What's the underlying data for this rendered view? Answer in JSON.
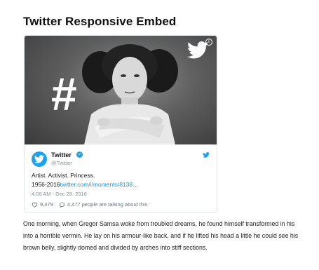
{
  "page": {
    "title": "Twitter Responsive Embed"
  },
  "embed": {
    "media": {
      "hashtag_glyph": "#",
      "bird_icon": "twitter-bird-icon",
      "info_icon": "info-icon",
      "info_glyph": "i"
    },
    "author": {
      "name": "Twitter",
      "handle": "@Twitter",
      "verified_glyph": "✓",
      "avatar_icon": "twitter-avatar"
    },
    "tweet": {
      "line1": "Artist. Activist. Princess.",
      "line2_prefix": "1956-2016",
      "link": "twitter.com/i/moments/8138…",
      "timestamp": "4:00 AM - Dec 28, 2016"
    },
    "actions": {
      "likes": "9,479",
      "talking": "4,477 people are talking about this"
    }
  },
  "article": {
    "text": "One morning, when Gregor Samsa woke from troubled dreams, he found himself transformed in his into a horrible vermin. He lay on his armour-like back, and if he lifted his head a little he could see his brown belly, slightly domed and divided by arches into stiff sections."
  },
  "colors": {
    "twitter_blue": "#1da1f2",
    "link_blue": "#1b95e0",
    "muted": "#8a959d"
  }
}
